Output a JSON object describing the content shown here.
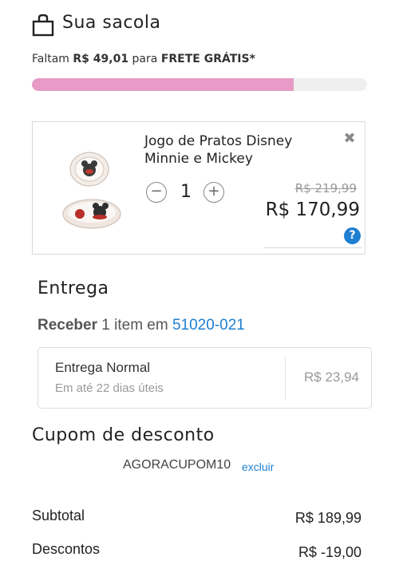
{
  "header": {
    "title": "Sua sacola",
    "icon": "shopping-bag-icon"
  },
  "shipping_progress": {
    "prefix": "Faltam",
    "amount": "R$ 49,01",
    "middle": "para",
    "highlight": "FRETE GRÁTIS*",
    "fill_fraction": 0.78,
    "fill_color": "#e79bc6",
    "track_color": "#efefef"
  },
  "cart_item": {
    "name": "Jogo de Pratos Disney Minnie e Mickey",
    "quantity": "1",
    "minus_symbol": "−",
    "plus_symbol": "+",
    "remove_symbol": "✖",
    "original_price": "R$ 219,99",
    "price": "R$ 170,99",
    "help_symbol": "?"
  },
  "delivery": {
    "title": "Entrega",
    "receive_bold": "Receber",
    "receive_text": "1 item em",
    "zip": "51020-021",
    "option": {
      "name": "Entrega Normal",
      "eta": "Em até 22 dias úteis",
      "price": "R$ 23,94"
    }
  },
  "coupon": {
    "title": "Cupom de desconto",
    "code": "AGORACUPOM10",
    "remove_label": "excluir"
  },
  "summary": {
    "subtotal_label": "Subtotal",
    "subtotal_value": "R$ 189,99",
    "discount_label": "Descontos",
    "discount_value": "R$ -19,00"
  },
  "colors": {
    "accent_blue": "#1f7fd1",
    "progress_pink": "#e79bc6"
  }
}
